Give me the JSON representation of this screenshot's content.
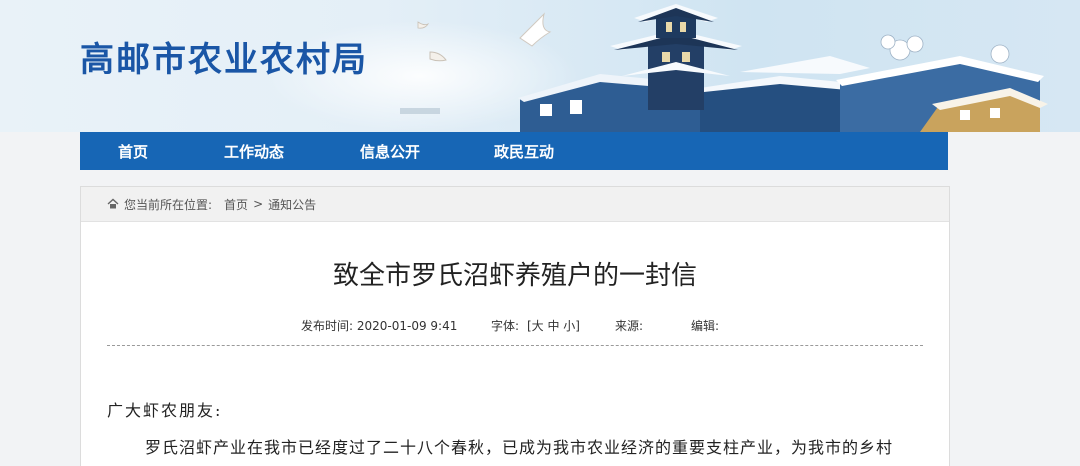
{
  "header": {
    "site_title": "高邮市农业农村局",
    "brand_color": "#1a56a6"
  },
  "nav": {
    "bg_color": "#1766b5",
    "items": [
      {
        "label": "首页"
      },
      {
        "label": "工作动态"
      },
      {
        "label": "信息公开"
      },
      {
        "label": "政民互动"
      }
    ]
  },
  "breadcrumb": {
    "prefix": "您当前所在位置:",
    "items": [
      "首页",
      "通知公告"
    ],
    "separator": ">"
  },
  "article": {
    "title": "致全市罗氏沼虾养殖户的一封信",
    "meta": {
      "publish_time": "发布时间: 2020-01-09 9:41",
      "font_label": "字体:",
      "font_sizes": "[大 中 小]",
      "source_label": "来源:",
      "editor_label": "编辑:"
    },
    "greeting": "广大虾农朋友:",
    "paragraph": "罗氏沼虾产业在我市已经度过了二十八个春秋，已成为我市农业经济的重要支柱产业，为我市的乡村"
  }
}
